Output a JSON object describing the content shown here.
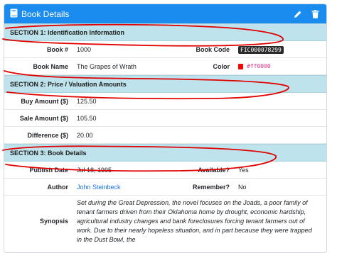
{
  "header": {
    "title": "Book Details",
    "book_icon": "book-icon",
    "edit_icon": "pencil-icon",
    "delete_icon": "trash-icon"
  },
  "sections": {
    "s1": "SECTION 1: Identification Information",
    "s2": "SECTION 2: Price / Valuation Amounts",
    "s3": "SECTION 3: Book Details"
  },
  "identification": {
    "book_no_label": "Book #",
    "book_no": "1000",
    "book_code_label": "Book Code",
    "book_code": "FIC000078299",
    "book_name_label": "Book Name",
    "book_name": "The Grapes of Wrath",
    "color_label": "Color",
    "color_value": "#ff0000"
  },
  "price": {
    "buy_label": "Buy Amount ($)",
    "buy": "125.50",
    "sale_label": "Sale Amount ($)",
    "sale": "105.50",
    "diff_label": "Difference ($)",
    "diff": "20.00"
  },
  "details": {
    "publish_label": "Publish Date",
    "publish": "Jul 18, 1995",
    "available_label": "Available?",
    "available": "Yes",
    "author_label": "Author",
    "author": "John Steinbeck",
    "remember_label": "Remember?",
    "remember": "No",
    "synopsis_label": "Synopsis",
    "synopsis": "Set during the Great Depression, the novel focuses on the Joads, a poor family of tenant farmers driven from their Oklahoma home by drought, economic hardship, agricultural industry changes and bank foreclosures forcing tenant farmers out of work. Due to their nearly hopeless situation, and in part because they were trapped in the Dust Bowl, the"
  },
  "colors": {
    "header_bg": "#1a8cf0",
    "section_bg": "#bfe3ec",
    "annotation": "#e00000",
    "swatch": "#ff0000"
  }
}
